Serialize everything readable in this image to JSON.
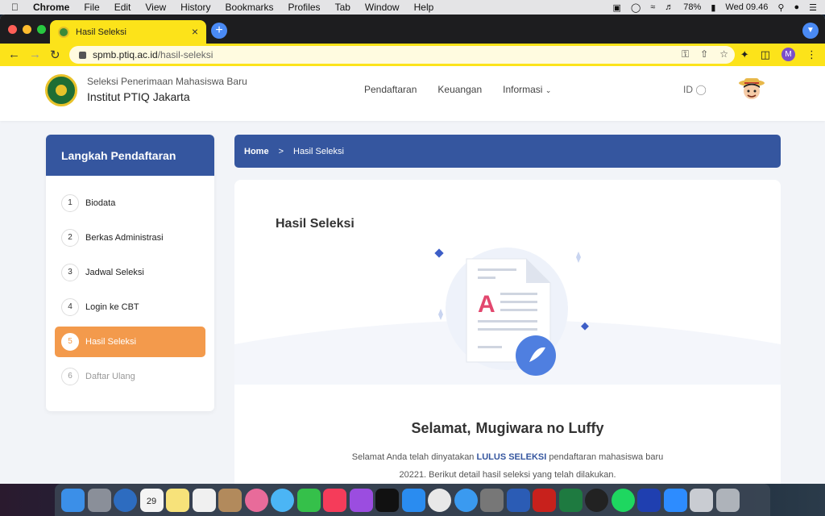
{
  "menubar": {
    "app_name": "Chrome",
    "items": [
      "File",
      "Edit",
      "View",
      "History",
      "Bookmarks",
      "Profiles",
      "Tab",
      "Window",
      "Help"
    ],
    "battery": "78%",
    "clock": "Wed 09.46"
  },
  "browser": {
    "tab_title": "Hasil Seleksi",
    "url_domain": "spmb.ptiq.ac.id",
    "url_path": "/hasil-seleksi",
    "profile_initial": "M",
    "accent": "#fce31a"
  },
  "site": {
    "brand_sub": "Seleksi Penerimaan Mahasiswa Baru",
    "brand_main": "Institut PTIQ Jakarta",
    "nav": [
      "Pendaftaran",
      "Keuangan",
      "Informasi"
    ],
    "lang": "ID"
  },
  "sidebar": {
    "title": "Langkah Pendaftaran",
    "steps": [
      {
        "num": "1",
        "label": "Biodata"
      },
      {
        "num": "2",
        "label": "Berkas Administrasi"
      },
      {
        "num": "3",
        "label": "Jadwal Seleksi"
      },
      {
        "num": "4",
        "label": "Login ke CBT"
      },
      {
        "num": "5",
        "label": "Hasil Seleksi"
      },
      {
        "num": "6",
        "label": "Daftar Ulang"
      }
    ]
  },
  "breadcrumb": {
    "home": "Home",
    "sep": ">",
    "current": "Hasil Seleksi"
  },
  "result": {
    "title": "Hasil Seleksi",
    "greeting": "Selamat,",
    "name": "Mugiwara no Luffy",
    "desc_prefix": "Selamat Anda telah dinyatakan",
    "desc_highlight": "LULUS SELEKSI",
    "desc_suffix": "pendaftaran mahasiswa baru",
    "desc_line2": "20221. Berikut detail hasil seleksi yang telah dilakukan.",
    "doc_letter": "A"
  },
  "calendar_day": "29",
  "colors": {
    "primary": "#35569f",
    "active_step": "#f39a4c"
  }
}
